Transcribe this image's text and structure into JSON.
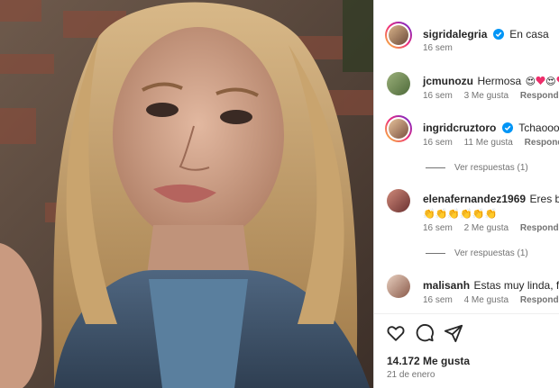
{
  "post": {
    "author": "sigridalegria",
    "caption": "En casa",
    "age": "16 sem"
  },
  "comments": [
    {
      "user": "jcmunozu",
      "text": "Hermosa",
      "age": "16 sem",
      "likes": "3 Me gusta",
      "reply": "Responder"
    },
    {
      "user": "ingridcruztoro",
      "text": "Tchaooooo",
      "age": "16 sem",
      "likes": "11 Me gusta",
      "reply": "Responder",
      "view_replies": "Ver respuestas (1)"
    },
    {
      "user": "elenafernandez1969",
      "text": "Eres bellís",
      "age": "16 sem",
      "likes": "2 Me gusta",
      "reply": "Responder",
      "view_replies": "Ver respuestas (1)"
    },
    {
      "user": "malisanh",
      "text": "Estas muy linda, felic",
      "age": "16 sem",
      "likes": "4 Me gusta",
      "reply": "Responder"
    }
  ],
  "footer": {
    "likes": "14.172 Me gusta",
    "date": "21 de enero"
  },
  "icons": {
    "like": "heart-outline-icon",
    "comment": "comment-bubble-icon",
    "share": "paper-plane-icon",
    "verified": "verified-badge-icon"
  },
  "colors": {
    "verified": "#0095f6",
    "emoji_heart": "#ed2e6b",
    "clap": "#f4c542"
  }
}
